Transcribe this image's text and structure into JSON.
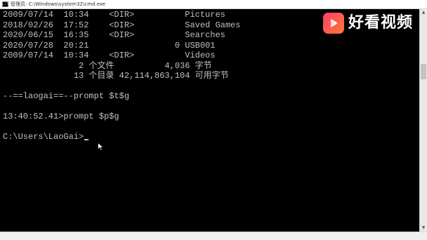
{
  "window": {
    "title": "管理员: C:\\Windows\\system32\\cmd.exe",
    "app_icon_glyph": "C:\\"
  },
  "console": {
    "lines": [
      "2009/07/14  10:34    <DIR>          Pictures",
      "2018/02/26  17:52    <DIR>          Saved Games",
      "2020/06/15  16:35    <DIR>          Searches",
      "2020/07/28  20:21                 0 USB001",
      "2009/07/14  10:34    <DIR>          Videos",
      "               2 个文件          4,036 字节",
      "              13 个目录 42,114,863,104 可用字节",
      "",
      "--==laogai==--prompt $t$g",
      "",
      "13:40:52.41>prompt $p$g",
      "",
      "C:\\Users\\LaoGai>"
    ]
  },
  "watermark": {
    "brand": "好看视频",
    "colors": {
      "logo_start": "#ff3d6e",
      "logo_end": "#ff7a2f"
    }
  },
  "colors": {
    "console_bg": "#000000",
    "console_fg": "#c0c0c0"
  }
}
